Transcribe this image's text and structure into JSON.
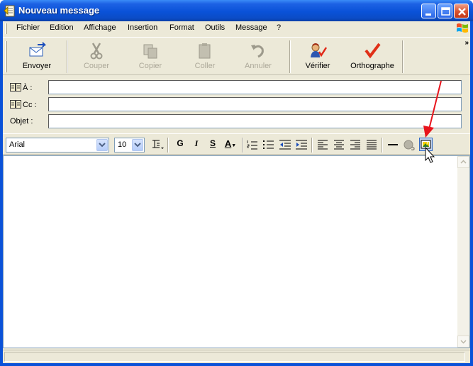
{
  "window": {
    "title": "Nouveau message",
    "controls": {
      "minimize": "minimize",
      "maximize": "maximize",
      "close": "close"
    }
  },
  "menubar": {
    "items": [
      "Fichier",
      "Edition",
      "Affichage",
      "Insertion",
      "Format",
      "Outils",
      "Message",
      "?"
    ]
  },
  "toolbar": {
    "buttons": [
      {
        "label": "Envoyer",
        "icon": "send-icon",
        "enabled": true
      },
      {
        "label": "Couper",
        "icon": "scissors-icon",
        "enabled": false
      },
      {
        "label": "Copier",
        "icon": "copy-icon",
        "enabled": false
      },
      {
        "label": "Coller",
        "icon": "paste-icon",
        "enabled": false
      },
      {
        "label": "Annuler",
        "icon": "undo-icon",
        "enabled": false
      },
      {
        "label": "Vérifier",
        "icon": "check-names-icon",
        "enabled": true
      },
      {
        "label": "Orthographe",
        "icon": "spelling-icon",
        "enabled": true
      }
    ],
    "overflow": "»"
  },
  "fields": {
    "to_label": "À :",
    "cc_label": "Cc :",
    "subject_label": "Objet :",
    "to_value": "",
    "cc_value": "",
    "subject_value": ""
  },
  "format": {
    "font": "Arial",
    "size": "10",
    "bold_label": "G",
    "italic_label": "I",
    "underline_label": "S",
    "color_label": "A"
  },
  "colors": {
    "title_blue": "#0a52d8",
    "face": "#ece9d8",
    "annotation_red": "#e8141c",
    "close_red": "#d8502c"
  }
}
